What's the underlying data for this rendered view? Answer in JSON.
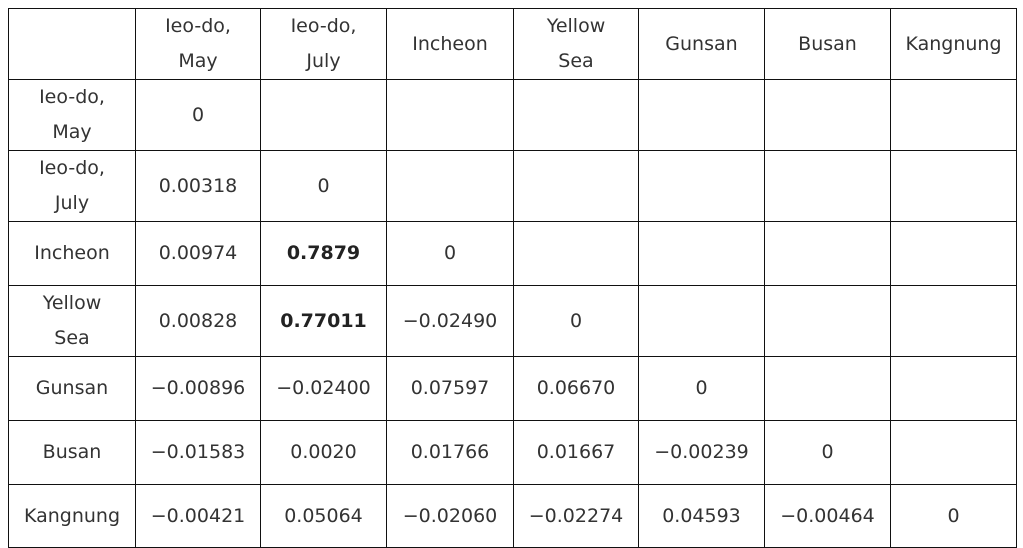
{
  "table": {
    "headers": [
      "",
      "Ieo-do,\nMay",
      "Ieo-do,\nJuly",
      "Incheon",
      "Yellow\nSea",
      "Gunsan",
      "Busan",
      "Kangnung"
    ],
    "header_lines": [
      [
        ""
      ],
      [
        "Ieo-do,",
        "May"
      ],
      [
        "Ieo-do,",
        "July"
      ],
      [
        "Incheon"
      ],
      [
        "Yellow",
        "Sea"
      ],
      [
        "Gunsan"
      ],
      [
        "Busan"
      ],
      [
        "Kangnung"
      ]
    ],
    "rows": [
      {
        "label_lines": [
          "Ieo-do,",
          "May"
        ],
        "cells": [
          "0",
          "",
          "",
          "",
          "",
          "",
          ""
        ]
      },
      {
        "label_lines": [
          "Ieo-do,",
          "July"
        ],
        "cells": [
          "0.00318",
          "0",
          "",
          "",
          "",
          "",
          ""
        ]
      },
      {
        "label_lines": [
          "Incheon"
        ],
        "cells": [
          "0.00974",
          "0.7879",
          "0",
          "",
          "",
          "",
          ""
        ]
      },
      {
        "label_lines": [
          "Yellow",
          "Sea"
        ],
        "cells": [
          "0.00828",
          "0.77011",
          "−0.02490",
          "0",
          "",
          "",
          ""
        ]
      },
      {
        "label_lines": [
          "Gunsan"
        ],
        "cells": [
          "−0.00896",
          "−0.02400",
          "0.07597",
          "0.06670",
          "0",
          "",
          ""
        ]
      },
      {
        "label_lines": [
          "Busan"
        ],
        "cells": [
          "−0.01583",
          "0.0020",
          "0.01766",
          "0.01667",
          "−0.00239",
          "0",
          ""
        ]
      },
      {
        "label_lines": [
          "Kangnung"
        ],
        "cells": [
          "−0.00421",
          "0.05064",
          "−0.02060",
          "−0.02274",
          "0.04593",
          "−0.00464",
          "0"
        ]
      }
    ],
    "emphasized_cells": [
      [
        2,
        1
      ],
      [
        3,
        1
      ]
    ]
  }
}
